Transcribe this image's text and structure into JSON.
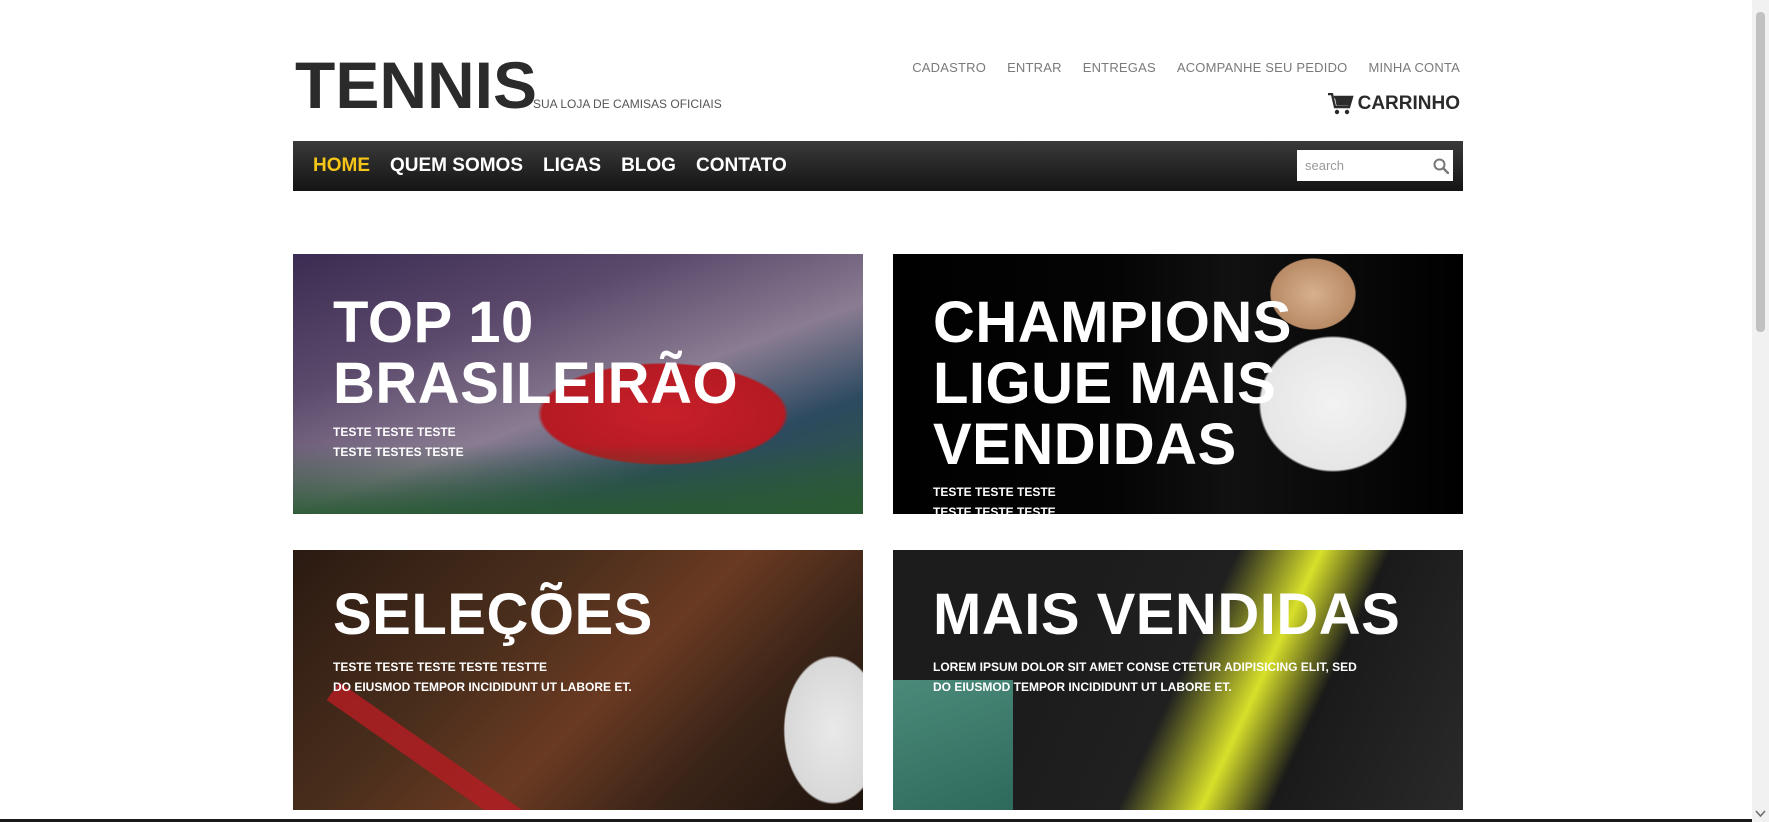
{
  "header": {
    "logo": "TENNIS",
    "tagline": "SUA LOJA DE CAMISAS OFICIAIS",
    "top_links": [
      "CADASTRO",
      "ENTRAR",
      "ENTREGAS",
      "ACOMPANHE SEU PEDIDO",
      "MINHA CONTA"
    ],
    "cart_label": "CARRINHO",
    "cart_icon": "cart-icon"
  },
  "nav": {
    "items": [
      {
        "label": "HOME",
        "active": true
      },
      {
        "label": "QUEM SOMOS",
        "active": false
      },
      {
        "label": "LIGAS",
        "active": false
      },
      {
        "label": "BLOG",
        "active": false
      },
      {
        "label": "CONTATO",
        "active": false
      }
    ],
    "search_placeholder": "search",
    "search_icon": "search-icon",
    "active_color": "#f5c518"
  },
  "banners": [
    {
      "title_lines": [
        "TOP 10",
        "BRASILEIRÃO"
      ],
      "desc_lines": [
        "TESTE TESTE TESTE",
        "TESTE TESTES TESTE"
      ]
    },
    {
      "title_lines": [
        "CHAMPIONS",
        "LIGUE MAIS",
        "VENDIDAS"
      ],
      "desc_lines": [
        "TESTE TESTE TESTE",
        "TESTE TESTE TESTE"
      ]
    },
    {
      "title_lines": [
        "SELEÇÕES"
      ],
      "desc_lines": [
        "TESTE TESTE TESTE TESTE TESTTE",
        "DO EIUSMOD TEMPOR INCIDIDUNT UT LABORE ET."
      ]
    },
    {
      "title_lines": [
        "MAIS VENDIDAS"
      ],
      "desc_lines": [
        "LOREM IPSUM DOLOR SIT AMET CONSE CTETUR ADIPISICING ELIT, SED",
        "DO EIUSMOD TEMPOR INCIDIDUNT UT LABORE ET."
      ]
    }
  ]
}
